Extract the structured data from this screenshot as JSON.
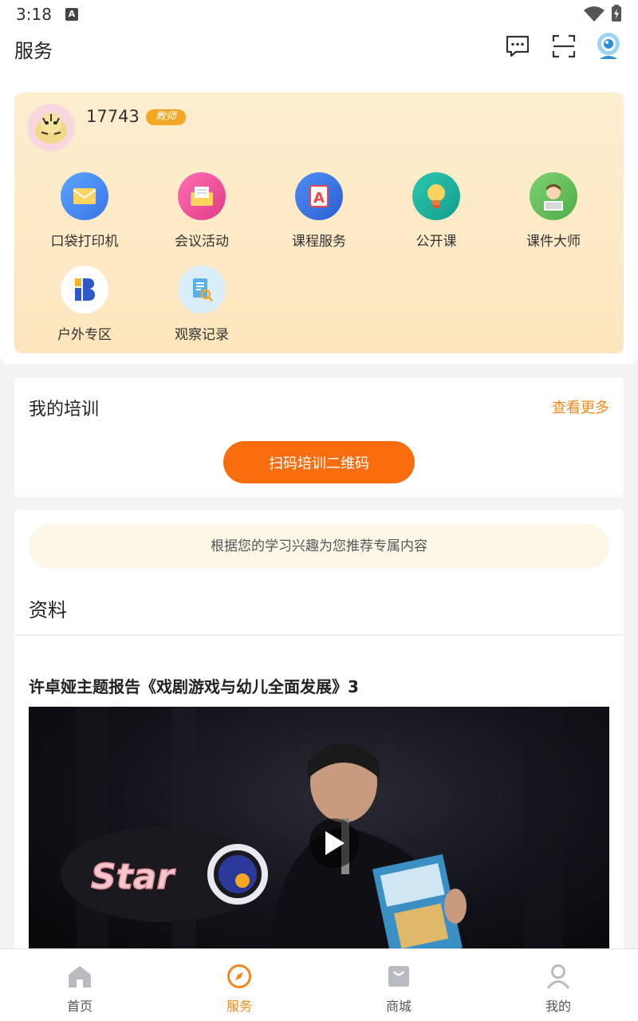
{
  "status_bar": {
    "time": "3:18",
    "notification_letter": "A"
  },
  "header": {
    "title": "服务"
  },
  "profile": {
    "username": "17743",
    "role": "教师"
  },
  "services": [
    {
      "label": "口袋打印机",
      "icon": "printer-envelope-icon",
      "color": "#4d8ff5"
    },
    {
      "label": "会议活动",
      "icon": "meeting-envelope-icon",
      "color": "#ef4a9a"
    },
    {
      "label": "课程服务",
      "icon": "course-book-icon",
      "color": "#3a6fe0"
    },
    {
      "label": "公开课",
      "icon": "lightbulb-icon",
      "color": "#1fb5a0"
    },
    {
      "label": "课件大师",
      "icon": "teacher-avatar-icon",
      "color": "#6fc46a"
    },
    {
      "label": "户外专区",
      "icon": "outdoor-logo-icon",
      "color": "#ffffff"
    },
    {
      "label": "观察记录",
      "icon": "observation-doc-icon",
      "color": "#d8ecf8"
    }
  ],
  "training": {
    "title": "我的培训",
    "more_label": "查看更多",
    "scan_button": "扫码培训二维码"
  },
  "recommend": {
    "banner": "根据您的学习兴趣为您推荐专属内容",
    "section_title": "资料",
    "video_title": "许卓娅主题报告《戏剧游戏与幼儿全面发展》3"
  },
  "bottom_nav": [
    {
      "label": "首页",
      "icon": "home-icon",
      "active": false
    },
    {
      "label": "服务",
      "icon": "compass-icon",
      "active": true
    },
    {
      "label": "商城",
      "icon": "shop-bag-icon",
      "active": false
    },
    {
      "label": "我的",
      "icon": "user-icon",
      "active": false
    }
  ],
  "colors": {
    "accent": "#f08a1c",
    "button": "#fa6d0f",
    "badge": "#f5a623"
  }
}
